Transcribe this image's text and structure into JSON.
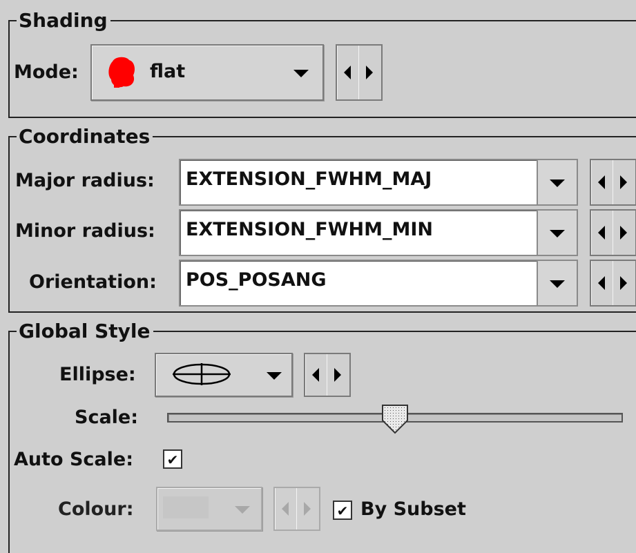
{
  "shading": {
    "title": "Shading",
    "mode_label": "Mode:",
    "mode_value": "flat",
    "mode_swatch_color": "#ff0000"
  },
  "coordinates": {
    "title": "Coordinates",
    "rows": [
      {
        "label": "Major radius:",
        "value": "EXTENSION_FWHM_MAJ"
      },
      {
        "label": "Minor radius:",
        "value": "EXTENSION_FWHM_MIN"
      },
      {
        "label": "Orientation:",
        "value": "POS_POSANG"
      }
    ]
  },
  "global_style": {
    "title": "Global Style",
    "ellipse_label": "Ellipse:",
    "ellipse_icon": "ellipse-crosshair-icon",
    "scale_label": "Scale:",
    "scale_fraction": 0.5,
    "auto_scale_label": "Auto Scale:",
    "auto_scale_checked": true,
    "colour_label": "Colour:",
    "by_subset_label": "By Subset",
    "by_subset_checked": true,
    "check_mark": "✔"
  }
}
